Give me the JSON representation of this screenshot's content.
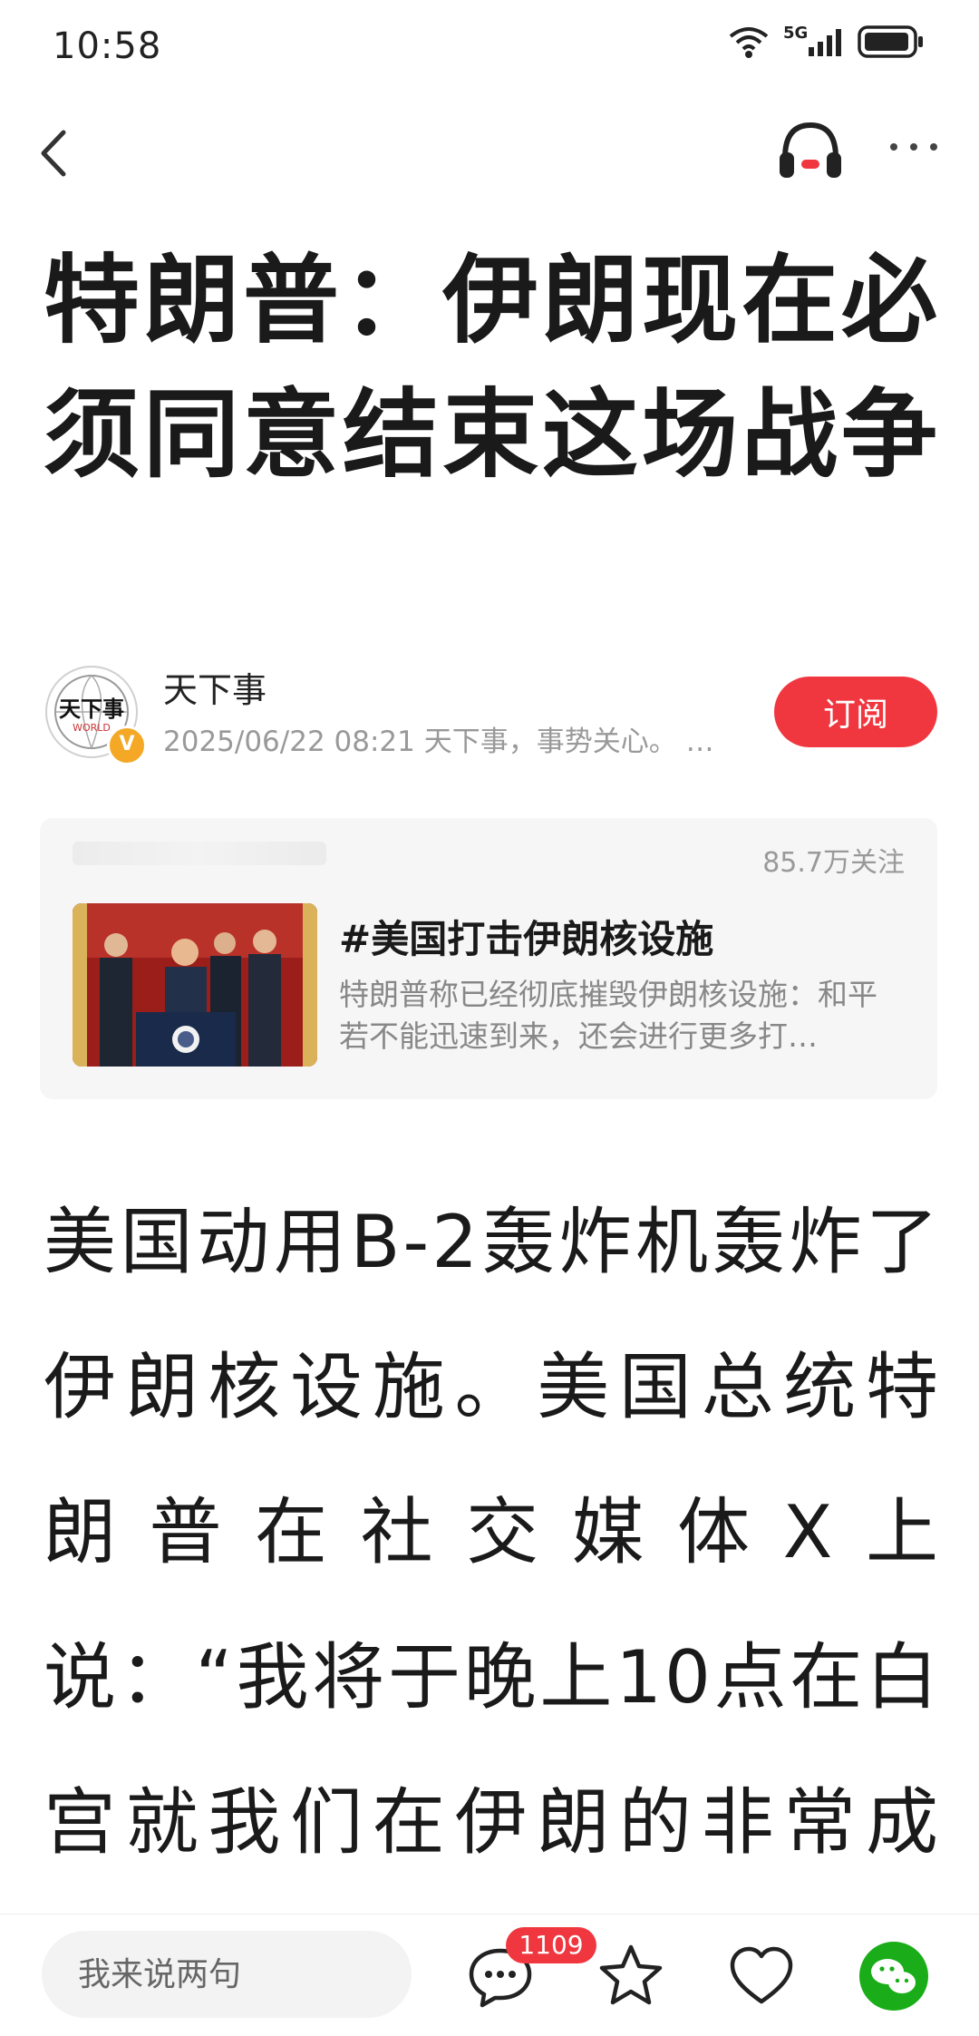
{
  "status_bar": {
    "time": "10:58",
    "network": "5G"
  },
  "article": {
    "title": "特朗普：伊朗现在必须同意结束这场战争",
    "author": {
      "name": "天下事",
      "meta": "2025/06/22 08:21 天下事，事势关心。 …",
      "avatar_text": "天下事",
      "avatar_subtext": "WORLD",
      "verified_mark": "V"
    },
    "subscribe_label": "订阅",
    "topic": {
      "followers": "85.7万关注",
      "title": "#美国打击伊朗核设施",
      "description": "特朗普称已经彻底摧毁伊朗核设施：和平若不能迅速到来，还会进行更多打…"
    },
    "body": "美国动用B-2轰炸机轰炸了伊朗核设施。美国总统特朗普在社交媒体X上说：“我将于晚上10点在白宫就我们在伊朗的非常成功的军事行动发表全国"
  },
  "bottom_bar": {
    "comment_placeholder": "我来说两句",
    "comment_count": "1109"
  },
  "colors": {
    "accent": "#f0373f",
    "verified": "#f4a825",
    "wechat": "#1aad19"
  },
  "icons": [
    "back-icon",
    "headphone-icon",
    "more-icon",
    "comment-icon",
    "star-icon",
    "heart-icon",
    "wechat-icon"
  ]
}
